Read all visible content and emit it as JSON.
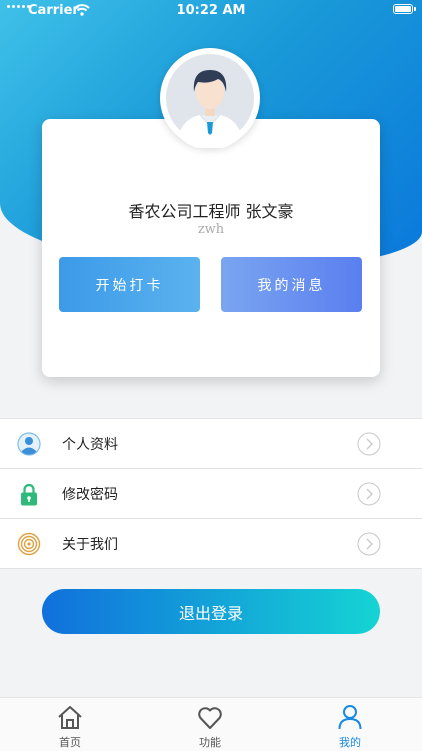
{
  "status_bar": {
    "carrier": "Carrier",
    "time": "10:22 AM",
    "battery_level": 1.0
  },
  "profile": {
    "name": "香农公司工程师 张文豪",
    "username": "zwh"
  },
  "actions": {
    "checkin_label": "开始打卡",
    "messages_label": "我的消息"
  },
  "menu": {
    "items": [
      {
        "label": "个人资料",
        "icon": "user-circle-icon"
      },
      {
        "label": "修改密码",
        "icon": "lock-icon"
      },
      {
        "label": "关于我们",
        "icon": "concentric-circles-icon"
      }
    ]
  },
  "logout_label": "退出登录",
  "tabbar": {
    "active_index": 2,
    "tabs": [
      {
        "label": "首页",
        "icon": "home-icon"
      },
      {
        "label": "功能",
        "icon": "heart-icon"
      },
      {
        "label": "我的",
        "icon": "person-icon"
      }
    ]
  },
  "colors": {
    "accent": "#1a8ae0",
    "header_gradient": [
      "#3fc1e9",
      "#0a78dc"
    ],
    "logout_gradient": [
      "#1170dc",
      "#15d4d4"
    ],
    "lock_green": "#2fb97a",
    "about_orange": "#e0a040"
  }
}
